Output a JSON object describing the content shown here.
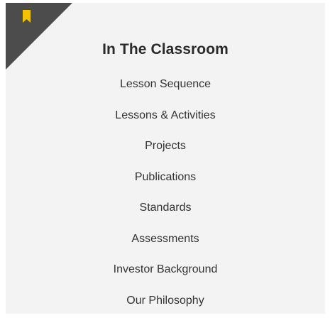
{
  "panel": {
    "title": "In The Classroom",
    "accent_color": "#f5c400",
    "corner_color": "#4c4c4c",
    "corner_icon": "bookmark-icon",
    "links": [
      {
        "label": "Lesson Sequence"
      },
      {
        "label": "Lessons & Activities"
      },
      {
        "label": "Projects"
      },
      {
        "label": "Publications"
      },
      {
        "label": "Standards"
      },
      {
        "label": "Assessments"
      },
      {
        "label": "Investor Background"
      },
      {
        "label": "Our Philosophy"
      }
    ]
  }
}
